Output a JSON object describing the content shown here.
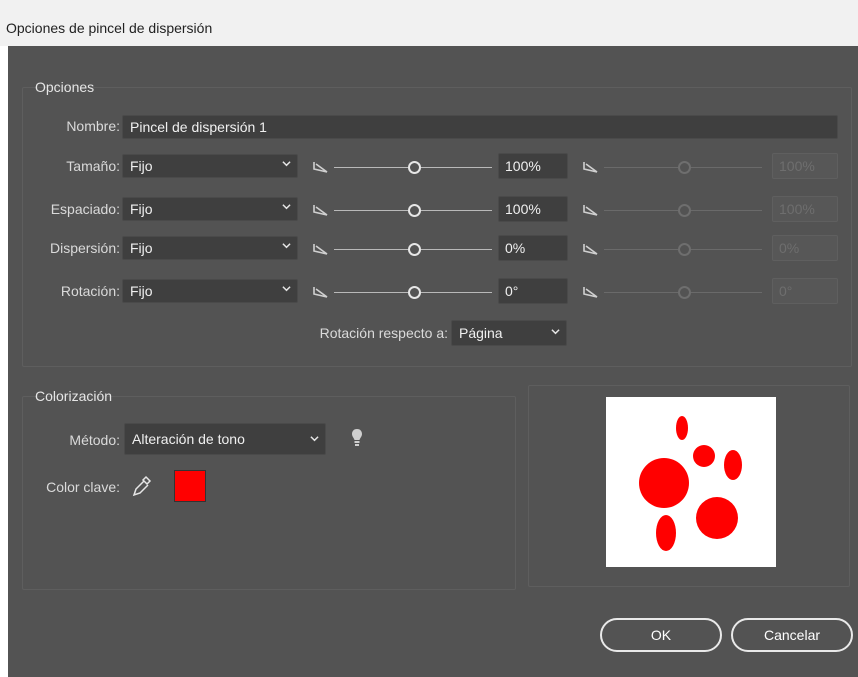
{
  "window": {
    "title": "Opciones de pincel de dispersión"
  },
  "options": {
    "legend": "Opciones",
    "name_label": "Nombre:",
    "name_value": "Pincel de dispersión 1",
    "rows": [
      {
        "label": "Tamaño:",
        "mode": "Fijo",
        "value": "100%",
        "value2": "100%"
      },
      {
        "label": "Espaciado:",
        "mode": "Fijo",
        "value": "100%",
        "value2": "100%"
      },
      {
        "label": "Dispersión:",
        "mode": "Fijo",
        "value": "0%",
        "value2": "0%"
      },
      {
        "label": "Rotación:",
        "mode": "Fijo",
        "value": "0°",
        "value2": "0°"
      }
    ],
    "rotation_relative_label": "Rotación respecto a:",
    "rotation_relative_value": "Página"
  },
  "colorization": {
    "legend": "Colorización",
    "method_label": "Método:",
    "method_value": "Alteración de tono",
    "key_color_label": "Color clave:",
    "key_color": "#ff0000",
    "tip_icon": "lightbulb-icon",
    "picker_icon": "eyedropper-icon"
  },
  "preview": {
    "shape_color": "#ff0000",
    "background": "#ffffff"
  },
  "buttons": {
    "ok": "OK",
    "cancel": "Cancelar"
  },
  "colors": {
    "dialog_bg": "#535353",
    "field_bg": "#3f3f3f",
    "text": "#e8e8e8"
  }
}
